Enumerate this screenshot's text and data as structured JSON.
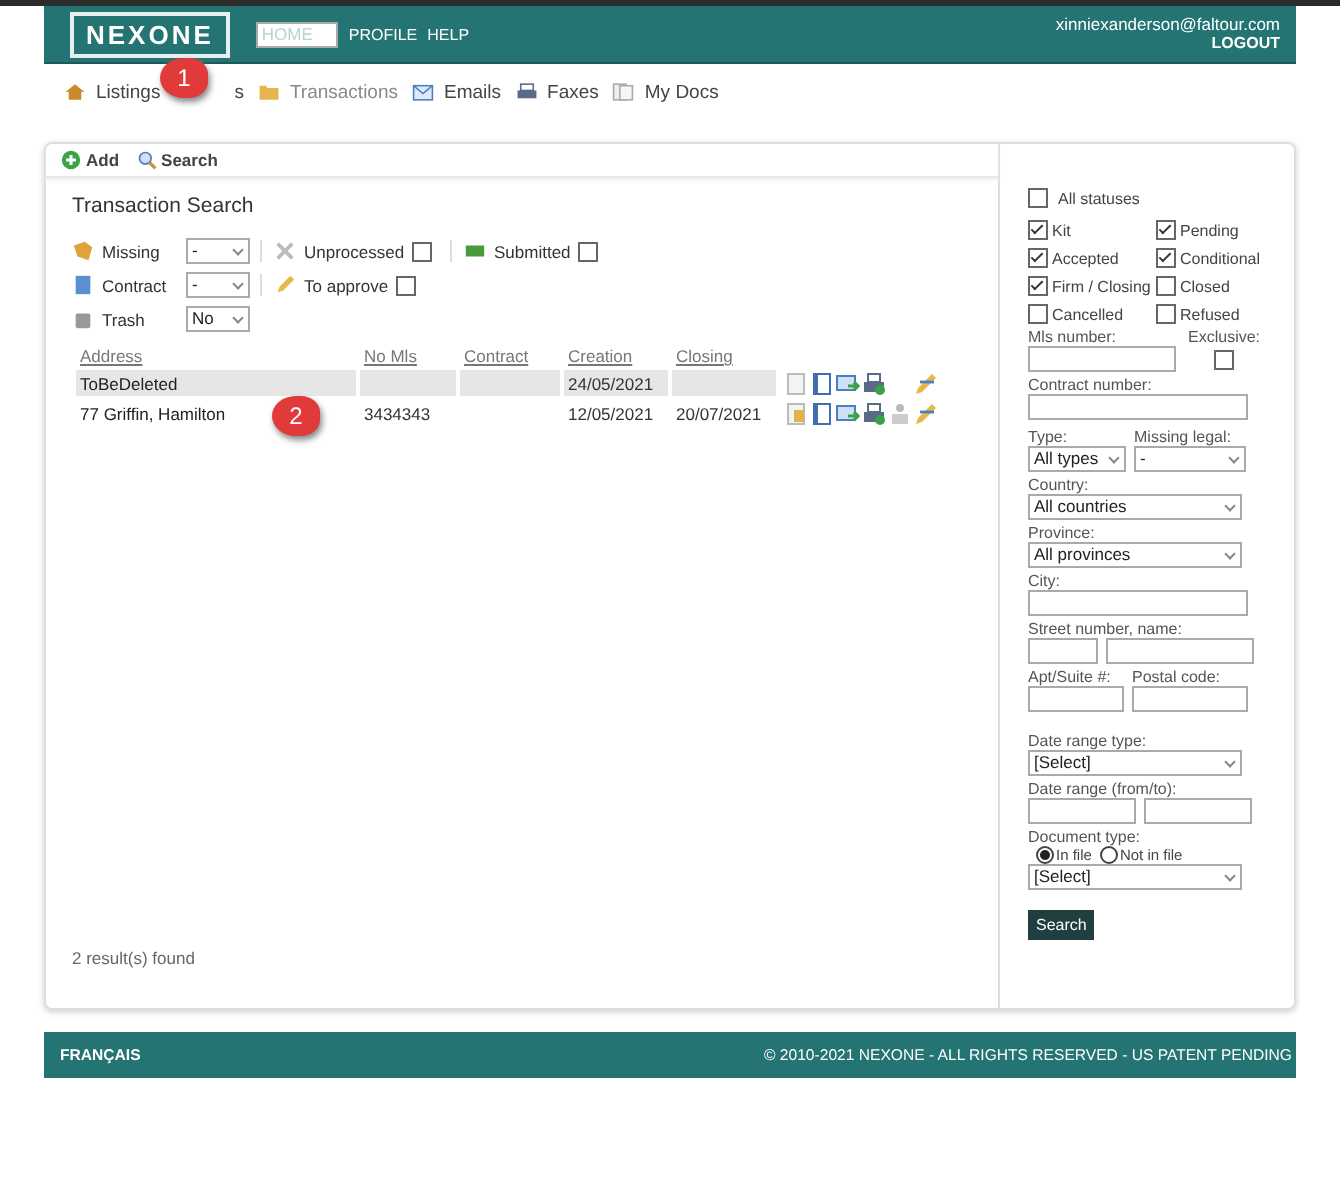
{
  "header": {
    "logo": "NEXONE",
    "nav": [
      {
        "label": "HOME",
        "selected": true
      },
      {
        "label": "PROFILE",
        "selected": false
      },
      {
        "label": "HELP",
        "selected": false
      }
    ],
    "user_email": "xinniexanderson@faltour.com",
    "logout": "LOGOUT"
  },
  "tabs": [
    {
      "label": "Listings",
      "selected": false
    },
    {
      "label": "s",
      "selected": false
    },
    {
      "label": "Transactions",
      "selected": true
    },
    {
      "label": "Emails",
      "selected": false
    },
    {
      "label": "Faxes",
      "selected": false
    },
    {
      "label": "My Docs",
      "selected": false
    }
  ],
  "callouts": [
    "1",
    "2"
  ],
  "toolbar": [
    "Add",
    "Search"
  ],
  "search": {
    "title": "Transaction Search",
    "filters": [
      [
        {
          "kind": "select",
          "label": "Missing",
          "value": "-"
        },
        {
          "kind": "check",
          "label": "Unprocessed",
          "checked": false
        },
        {
          "kind": "check",
          "label": "Submitted",
          "checked": false
        }
      ],
      [
        {
          "kind": "select",
          "label": "Contract",
          "value": "-"
        },
        {
          "kind": "check",
          "label": "To approve",
          "checked": false
        }
      ],
      [
        {
          "kind": "select",
          "label": "Trash",
          "value": "No"
        }
      ]
    ]
  },
  "table": {
    "columns": [
      "Address",
      "No Mls",
      "Contract",
      "Creation",
      "Closing"
    ],
    "rows": [
      {
        "cells": [
          "ToBeDeleted",
          "",
          "",
          "24/05/2021",
          ""
        ],
        "shaded": true
      },
      {
        "cells": [
          "77 Griffin, Hamilton",
          "3434343",
          "",
          "12/05/2021",
          "20/07/2021"
        ],
        "shaded": false
      }
    ]
  },
  "results": "2 result(s) found",
  "sidebar": {
    "all_statuses": {
      "label": "All statuses",
      "checked": false
    },
    "statuses": [
      {
        "label": "Kit",
        "checked": true
      },
      {
        "label": "Pending",
        "checked": true
      },
      {
        "label": "Accepted",
        "checked": true
      },
      {
        "label": "Conditional",
        "checked": true
      },
      {
        "label": "Firm / Closing",
        "checked": true
      },
      {
        "label": "Closed",
        "checked": false
      },
      {
        "label": "Cancelled",
        "checked": false
      },
      {
        "label": "Refused",
        "checked": false
      }
    ],
    "mls_label": "Mls number:",
    "exclusive": {
      "label": "Exclusive:",
      "checked": false
    },
    "contract_label": "Contract number:",
    "type": {
      "label": "Type:",
      "value": "All types"
    },
    "missing_legal": {
      "label": "Missing legal:",
      "value": "-"
    },
    "country": {
      "label": "Country:",
      "value": "All countries"
    },
    "province": {
      "label": "Province:",
      "value": "All provinces"
    },
    "city_label": "City:",
    "street_label": "Street number, name:",
    "apt_label": "Apt/Suite #:",
    "postal_label": "Postal code:",
    "date_type": {
      "label": "Date range type:",
      "value": "[Select]"
    },
    "date_range_label": "Date range (from/to):",
    "doc_type": {
      "label": "Document type:",
      "options": [
        {
          "label": "In file",
          "selected": true
        },
        {
          "label": "Not in file",
          "selected": false
        }
      ],
      "value": "[Select]"
    },
    "search_button": "Search"
  },
  "footer": {
    "language": "FRANÇAIS",
    "copyright": "© 2010-2021 NEXONE - ALL RIGHTS RESERVED - US PATENT PENDING"
  }
}
